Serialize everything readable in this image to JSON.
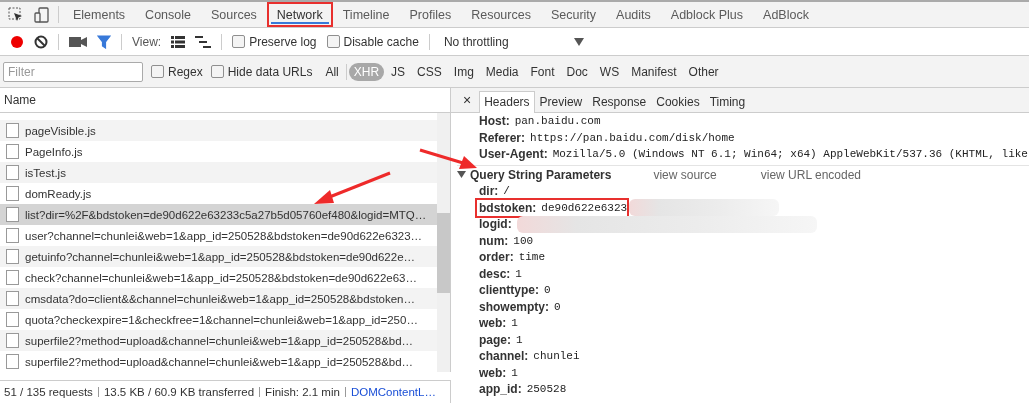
{
  "tabs": [
    {
      "label": "Elements",
      "selected": false,
      "highlighted": false
    },
    {
      "label": "Console",
      "selected": false,
      "highlighted": false
    },
    {
      "label": "Sources",
      "selected": false,
      "highlighted": false
    },
    {
      "label": "Network",
      "selected": true,
      "highlighted": true
    },
    {
      "label": "Timeline",
      "selected": false,
      "highlighted": false
    },
    {
      "label": "Profiles",
      "selected": false,
      "highlighted": false
    },
    {
      "label": "Resources",
      "selected": false,
      "highlighted": false
    },
    {
      "label": "Security",
      "selected": false,
      "highlighted": false
    },
    {
      "label": "Audits",
      "selected": false,
      "highlighted": false
    },
    {
      "label": "Adblock Plus",
      "selected": false,
      "highlighted": false
    },
    {
      "label": "AdBlock",
      "selected": false,
      "highlighted": false
    }
  ],
  "toolbar": {
    "recording": true,
    "filter_active": true,
    "view_label": "View:",
    "checkboxes": [
      {
        "label": "Preserve log",
        "checked": false
      },
      {
        "label": "Disable cache",
        "checked": false
      }
    ],
    "throttling": "No throttling"
  },
  "filter_bar": {
    "placeholder": "Filter",
    "checkboxes": [
      {
        "label": "Regex",
        "checked": false
      },
      {
        "label": "Hide data URLs",
        "checked": false
      }
    ],
    "types": [
      {
        "label": "All",
        "selected": false
      },
      {
        "label": "XHR",
        "selected": true
      },
      {
        "label": "JS",
        "selected": false
      },
      {
        "label": "CSS",
        "selected": false
      },
      {
        "label": "Img",
        "selected": false
      },
      {
        "label": "Media",
        "selected": false
      },
      {
        "label": "Font",
        "selected": false
      },
      {
        "label": "Doc",
        "selected": false
      },
      {
        "label": "WS",
        "selected": false
      },
      {
        "label": "Manifest",
        "selected": false
      },
      {
        "label": "Other",
        "selected": false
      }
    ]
  },
  "requests": {
    "column": "Name",
    "rows": [
      {
        "name": "pageVisible.js",
        "selected": false
      },
      {
        "name": "PageInfo.js",
        "selected": false
      },
      {
        "name": "isTest.js",
        "selected": false
      },
      {
        "name": "domReady.js",
        "selected": false
      },
      {
        "name": "list?dir=%2F&bdstoken=de90d622e63233c5a27b5d05760ef480&logid=MTQ…",
        "selected": true
      },
      {
        "name": "user?channel=chunlei&web=1&app_id=250528&bdstoken=de90d622e6323…",
        "selected": false
      },
      {
        "name": "getuinfo?channel=chunlei&web=1&app_id=250528&bdstoken=de90d622e…",
        "selected": false
      },
      {
        "name": "check?channel=chunlei&web=1&app_id=250528&bdstoken=de90d622e63…",
        "selected": false
      },
      {
        "name": "cmsdata?do=client&&channel=chunlei&web=1&app_id=250528&bdstoken…",
        "selected": false
      },
      {
        "name": "quota?checkexpire=1&checkfree=1&channel=chunlei&web=1&app_id=250…",
        "selected": false
      },
      {
        "name": "superfile2?method=upload&channel=chunlei&web=1&app_id=250528&bd…",
        "selected": false
      },
      {
        "name": "superfile2?method=upload&channel=chunlei&web=1&app_id=250528&bd…",
        "selected": false
      }
    ]
  },
  "status_bar": [
    {
      "kind": "text",
      "text": "51 / 135 requests"
    },
    {
      "kind": "text",
      "text": "13.5 KB / 60.9 KB transferred"
    },
    {
      "kind": "text",
      "text": "Finish: 2.1 min"
    },
    {
      "kind": "link",
      "text": "DOMContentL…"
    }
  ],
  "details": {
    "tabs": [
      {
        "label": "Headers",
        "selected": true
      },
      {
        "label": "Preview",
        "selected": false
      },
      {
        "label": "Response",
        "selected": false
      },
      {
        "label": "Cookies",
        "selected": false
      },
      {
        "label": "Timing",
        "selected": false
      }
    ],
    "close": "×",
    "headers": [
      {
        "name": "Host:",
        "value": "pan.baidu.com"
      },
      {
        "name": "Referer:",
        "value": "https://pan.baidu.com/disk/home"
      },
      {
        "name": "User-Agent:",
        "value": "Mozilla/5.0 (Windows NT 6.1; Win64; x64) AppleWebKit/537.36 (KHTML, like"
      }
    ],
    "query": {
      "title": "Query String Parameters",
      "expanded": true,
      "links": [
        "view source",
        "view URL encoded"
      ],
      "params": [
        {
          "name": "dir:",
          "value": "/",
          "highlighted": false,
          "redacted": false
        },
        {
          "name": "bdstoken:",
          "value": "de90d622e6323",
          "highlighted": true,
          "redacted": true
        },
        {
          "name": "logid:",
          "highlighted": false,
          "redacted": true
        },
        {
          "name": "num:",
          "value": "100",
          "highlighted": false,
          "redacted": false
        },
        {
          "name": "order:",
          "value": "time",
          "highlighted": false,
          "redacted": false
        },
        {
          "name": "desc:",
          "value": "1",
          "highlighted": false,
          "redacted": false
        },
        {
          "name": "clienttype:",
          "value": "0",
          "highlighted": false,
          "redacted": false
        },
        {
          "name": "showempty:",
          "value": "0",
          "highlighted": false,
          "redacted": false
        },
        {
          "name": "web:",
          "value": "1",
          "highlighted": false,
          "redacted": false
        },
        {
          "name": "page:",
          "value": "1",
          "highlighted": false,
          "redacted": false
        },
        {
          "name": "channel:",
          "value": "chunlei",
          "highlighted": false,
          "redacted": false
        },
        {
          "name": "web:",
          "value": "1",
          "highlighted": false,
          "redacted": false
        },
        {
          "name": "app_id:",
          "value": "250528",
          "highlighted": false,
          "redacted": false
        }
      ]
    }
  }
}
